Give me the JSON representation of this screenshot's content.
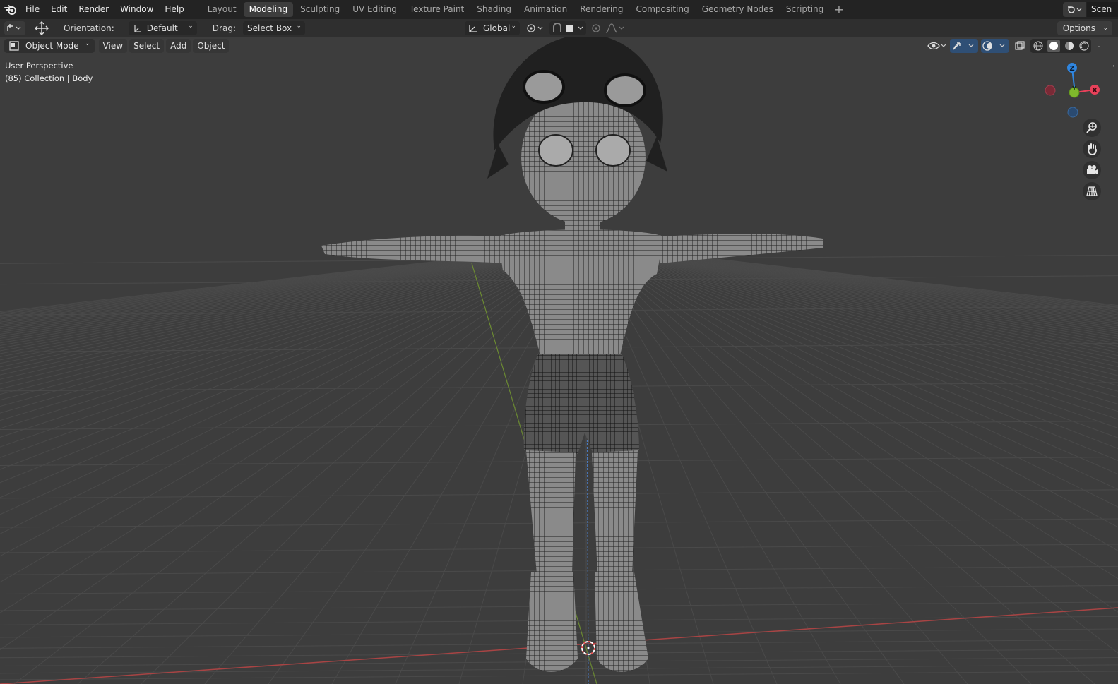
{
  "menu": {
    "items": [
      "File",
      "Edit",
      "Render",
      "Window",
      "Help"
    ]
  },
  "workspace_tabs": [
    {
      "label": "Layout",
      "active": false
    },
    {
      "label": "Modeling",
      "active": true
    },
    {
      "label": "Sculpting",
      "active": false
    },
    {
      "label": "UV Editing",
      "active": false
    },
    {
      "label": "Texture Paint",
      "active": false
    },
    {
      "label": "Shading",
      "active": false
    },
    {
      "label": "Animation",
      "active": false
    },
    {
      "label": "Rendering",
      "active": false
    },
    {
      "label": "Compositing",
      "active": false
    },
    {
      "label": "Geometry Nodes",
      "active": false
    },
    {
      "label": "Scripting",
      "active": false
    }
  ],
  "scene": {
    "name": "Scen"
  },
  "tool_header": {
    "orientation_label": "Orientation:",
    "orientation_value": "Default",
    "drag_label": "Drag:",
    "drag_value": "Select Box",
    "transform_orientation": "Global",
    "options_label": "Options"
  },
  "viewport": {
    "mode": "Object Mode",
    "menu": [
      "View",
      "Select",
      "Add",
      "Object"
    ],
    "perspective_text": "User Perspective",
    "collection_text": "(85) Collection | Body"
  },
  "gizmo": {
    "z_label": "Z",
    "y_label": "Y",
    "x_label": "X",
    "colors": {
      "x": "#e8415a",
      "y": "#7fb92c",
      "z": "#2f86e0"
    }
  },
  "colors": {
    "topbar": "#232323",
    "header": "#2f2f2f",
    "viewport_bg": "#3d3d3d",
    "grid_line": "#4a4a4a",
    "active_tab": "#3d3d3d",
    "x_axis": "#b84a4a",
    "y_axis": "#7a9a40",
    "z_axis": "#4a7ac0"
  },
  "icons": [
    "blender-logo-icon",
    "transform-icon",
    "move-icon",
    "global-orientation-icon",
    "pivot-icon",
    "snap-icon",
    "proportional-icon",
    "visibility-icon",
    "gizmo-icon",
    "overlay-icon",
    "xray-icon",
    "wireframe-shading-icon",
    "solid-shading-icon",
    "material-shading-icon",
    "rendered-shading-icon",
    "zoom-icon",
    "hand-pan-icon",
    "camera-icon",
    "grid-view-icon"
  ]
}
